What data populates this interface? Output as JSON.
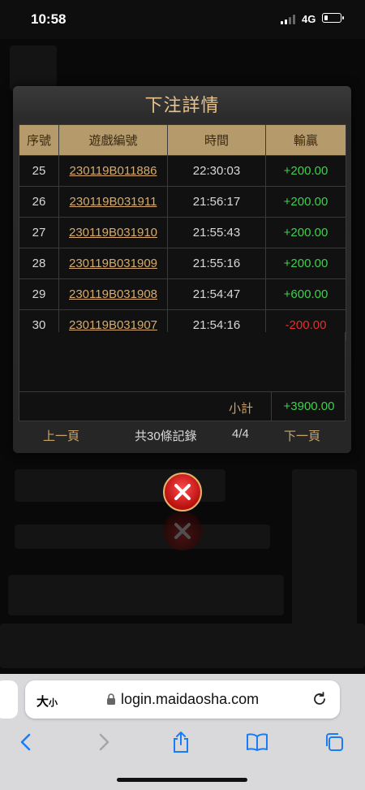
{
  "status_bar": {
    "time": "10:58",
    "network": "4G"
  },
  "dialog": {
    "title": "下注詳情",
    "columns": [
      "序號",
      "遊戲編號",
      "時間",
      "輸贏"
    ],
    "rows": [
      {
        "no": "25",
        "game_id": "230119B011886",
        "time": "22:30:03",
        "amount": "+200.00",
        "result": "win"
      },
      {
        "no": "26",
        "game_id": "230119B031911",
        "time": "21:56:17",
        "amount": "+200.00",
        "result": "win"
      },
      {
        "no": "27",
        "game_id": "230119B031910",
        "time": "21:55:43",
        "amount": "+200.00",
        "result": "win"
      },
      {
        "no": "28",
        "game_id": "230119B031909",
        "time": "21:55:16",
        "amount": "+200.00",
        "result": "win"
      },
      {
        "no": "29",
        "game_id": "230119B031908",
        "time": "21:54:47",
        "amount": "+600.00",
        "result": "win"
      },
      {
        "no": "30",
        "game_id": "230119B031907",
        "time": "21:54:16",
        "amount": "-200.00",
        "result": "loss"
      }
    ],
    "subtotal_label": "小計",
    "subtotal_value": "+3900.00",
    "pager": {
      "prev": "上一頁",
      "count": "共30條記錄",
      "page": "4/4",
      "next": "下一頁"
    }
  },
  "browser": {
    "text_size_label": "大",
    "text_size_small": "小",
    "url": "login.maidaosha.com"
  },
  "colors": {
    "gold": "#c9a46a",
    "win": "#3fcf4f",
    "loss": "#e03030",
    "header_bg": "#b59a6b"
  }
}
